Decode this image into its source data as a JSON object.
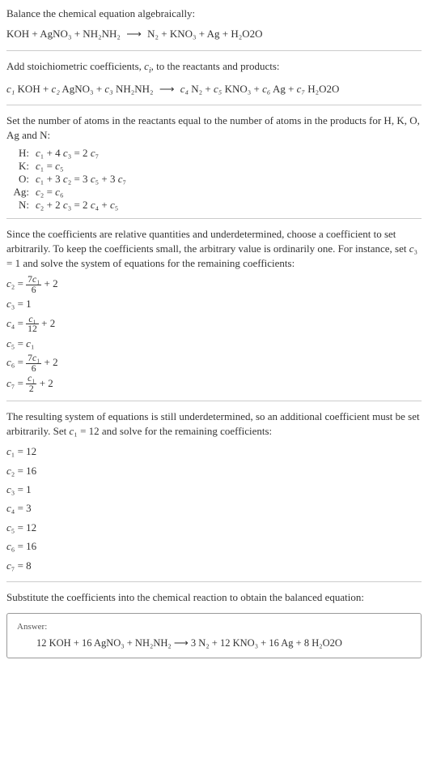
{
  "step1": {
    "title": "Balance the chemical equation algebraically:",
    "reaction": {
      "left": "KOH + AgNO₃ + NH₂NH₂",
      "arrow": "⟶",
      "right": "N₂ + KNO₃ + Ag + H₂O2O"
    }
  },
  "step2": {
    "title_a": "Add stoichiometric coefficients, ",
    "title_ci": "c",
    "title_i": "i",
    "title_b": ", to the reactants and products:",
    "reaction": {
      "c1": "c₁",
      "r1": " KOH + ",
      "c2": "c₂",
      "r2": " AgNO₃ + ",
      "c3": "c₃",
      "r3": " NH₂NH₂",
      "arrow": "⟶",
      "c4": "c₄",
      "r4": " N₂ + ",
      "c5": "c₅",
      "r5": " KNO₃ + ",
      "c6": "c₆",
      "r6": " Ag + ",
      "c7": "c₇",
      "r7": " H₂O2O"
    }
  },
  "step3": {
    "title": "Set the number of atoms in the reactants equal to the number of atoms in the products for H, K, O, Ag and N:",
    "rows": [
      {
        "label": "H:",
        "eq_a": "c",
        "eq_b": "₁ + 4 ",
        "eq_c": "c",
        "eq_d": "₃ = 2 ",
        "eq_e": "c",
        "eq_f": "₇"
      },
      {
        "label": "K:",
        "eq_a": "c",
        "eq_b": "₁ = ",
        "eq_c": "c",
        "eq_d": "₅",
        "eq_e": "",
        "eq_f": ""
      },
      {
        "label": "O:",
        "eq_a": "c",
        "eq_b": "₁ + 3 ",
        "eq_c": "c",
        "eq_d": "₂ = 3 ",
        "eq_e": "c",
        "eq_f": "₅ + 3 ",
        "eq_g": "c",
        "eq_h": "₇"
      },
      {
        "label": "Ag:",
        "eq_a": "c",
        "eq_b": "₂ = ",
        "eq_c": "c",
        "eq_d": "₆",
        "eq_e": "",
        "eq_f": ""
      },
      {
        "label": "N:",
        "eq_a": "c",
        "eq_b": "₂ + 2 ",
        "eq_c": "c",
        "eq_d": "₃ = 2 ",
        "eq_e": "c",
        "eq_f": "₄ + ",
        "eq_g": "c",
        "eq_h": "₅"
      }
    ]
  },
  "step4": {
    "title_a": "Since the coefficients are relative quantities and underdetermined, choose a coefficient to set arbitrarily. To keep the coefficients small, the arbitrary value is ordinarily one. For instance, set ",
    "c3": "c",
    "sub3": "₃",
    "eq1": " = 1 and solve the system of equations for the remaining coefficients:",
    "rows": {
      "r2": {
        "lhs_c": "c",
        "lhs_s": "₂",
        "eq": " = ",
        "num_a": "7",
        "num_c": "c",
        "num_s": "₁",
        "den": "6",
        "tail": " + 2"
      },
      "r3": {
        "lhs_c": "c",
        "lhs_s": "₃",
        "eq": " = 1"
      },
      "r4": {
        "lhs_c": "c",
        "lhs_s": "₄",
        "eq": " = ",
        "num_c": "c",
        "num_s": "₁",
        "den": "12",
        "tail": " + 2"
      },
      "r5": {
        "lhs_c": "c",
        "lhs_s": "₅",
        "eq": " = ",
        "rhs_c": "c",
        "rhs_s": "₁"
      },
      "r6": {
        "lhs_c": "c",
        "lhs_s": "₆",
        "eq": " = ",
        "num_a": "7",
        "num_c": "c",
        "num_s": "₁",
        "den": "6",
        "tail": " + 2"
      },
      "r7": {
        "lhs_c": "c",
        "lhs_s": "₇",
        "eq": " = ",
        "num_c": "c",
        "num_s": "₁",
        "den": "2",
        "tail": " + 2"
      }
    }
  },
  "step5": {
    "title_a": "The resulting system of equations is still underdetermined, so an additional coefficient must be set arbitrarily. Set ",
    "c1": "c",
    "sub1": "₁",
    "eq1": " = 12 and solve for the remaining coefficients:",
    "rows": [
      {
        "c": "c",
        "s": "₁",
        "val": " = 12"
      },
      {
        "c": "c",
        "s": "₂",
        "val": " = 16"
      },
      {
        "c": "c",
        "s": "₃",
        "val": " = 1"
      },
      {
        "c": "c",
        "s": "₄",
        "val": " = 3"
      },
      {
        "c": "c",
        "s": "₅",
        "val": " = 12"
      },
      {
        "c": "c",
        "s": "₆",
        "val": " = 16"
      },
      {
        "c": "c",
        "s": "₇",
        "val": " = 8"
      }
    ]
  },
  "step6": {
    "title": "Substitute the coefficients into the chemical reaction to obtain the balanced equation:"
  },
  "answer": {
    "label": "Answer:",
    "eq": "12 KOH + 16 AgNO₃ + NH₂NH₂  ⟶  3 N₂ + 12 KNO₃ + 16 Ag + 8 H₂O2O"
  }
}
